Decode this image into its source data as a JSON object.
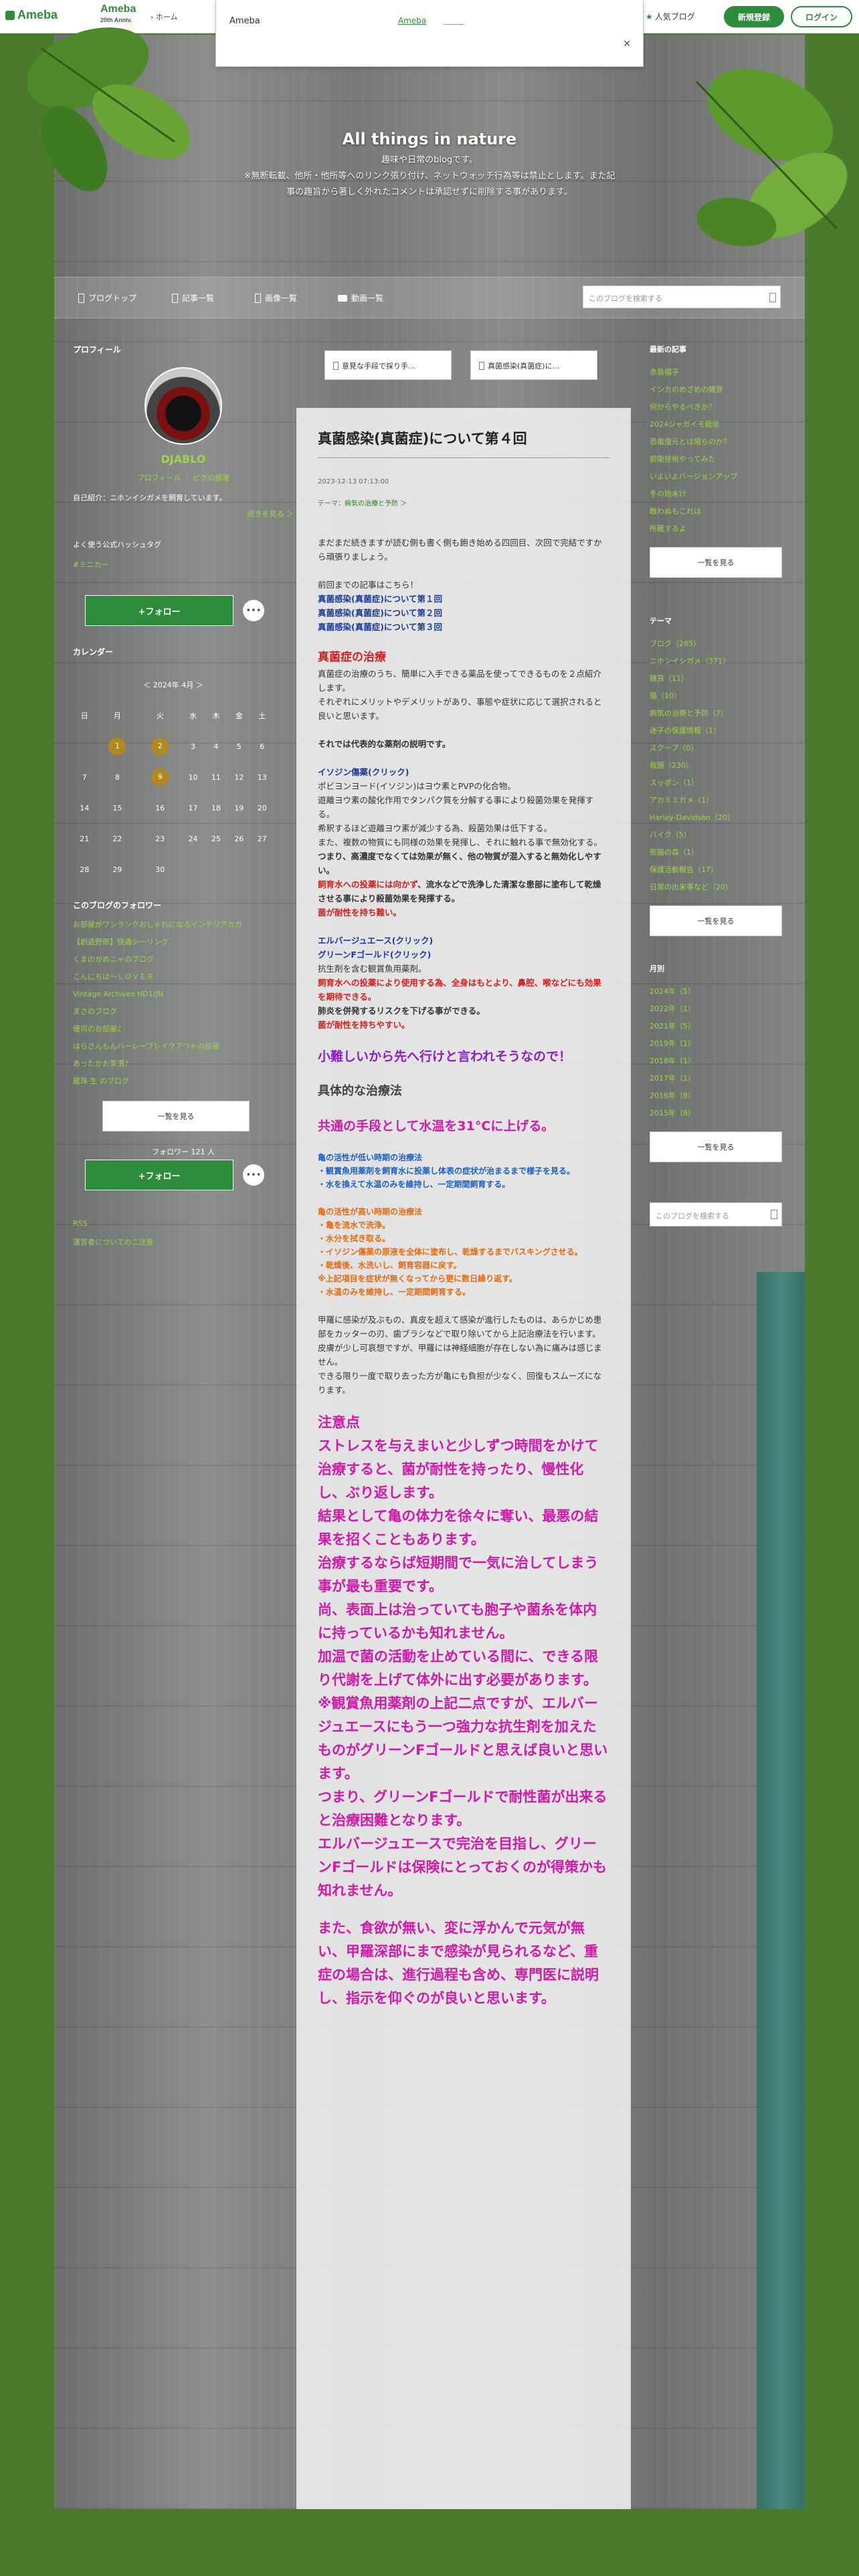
{
  "topbar": {
    "logo": "Ameba",
    "anniv_title": "Ameba",
    "anniv_sub": "20th Anniv.",
    "home": "› ホーム",
    "popular": "人気ブログ",
    "register": "新規登録",
    "login": "ログイン"
  },
  "ad": {
    "label": "Ameba",
    "link": "Ameba",
    "close": "✕"
  },
  "header": {
    "title": "All things in nature",
    "desc_lines": [
      "趣味や日常のblogです。",
      "※無断転載、他所・他所等へのリンク張り付け、ネットウォッチ行為等は禁止とします。また記事の趣旨から著しく外れたコメントは承認せずに削除する事があります。"
    ]
  },
  "nav": {
    "top": "ブログトップ",
    "posts": "記事一覧",
    "images": "画像一覧",
    "videos": "動画一覧",
    "search_placeholder": "このブログを検索する"
  },
  "profile": {
    "heading": "プロフィール",
    "name": "DJABLO",
    "links": "プロフィール ｜ ピグの部屋",
    "intro": "自己紹介：ニホンイシガメを飼育しています。",
    "more": "続きを見る ＞",
    "hash_heading": "よく使う公式ハッシュタグ",
    "hash_tag": "#ミニカー",
    "follow": "+フォロー",
    "dots": "•••"
  },
  "calendar": {
    "heading": "カレンダー",
    "title": "＜  2024年 4月  ＞",
    "weekdays": [
      "日",
      "月",
      "火",
      "水",
      "木",
      "金",
      "土"
    ],
    "rows": [
      [
        "",
        "1",
        "2",
        "3",
        "4",
        "5",
        "6"
      ],
      [
        "7",
        "8",
        "9",
        "10",
        "11",
        "12",
        "13"
      ],
      [
        "14",
        "15",
        "16",
        "17",
        "18",
        "19",
        "20"
      ],
      [
        "21",
        "22",
        "23",
        "24",
        "25",
        "26",
        "27"
      ],
      [
        "28",
        "29",
        "30",
        "",
        "",
        "",
        ""
      ]
    ]
  },
  "followers": {
    "heading": "このブログのフォロワー",
    "items": [
      "お部屋がワンランクおしゃれになるインテリアカガ",
      "【創造野郎】快適シーリング",
      "くまのかめニャのブログ",
      "こんにちは〜ＬＯＶＥＲ",
      "Vintage Archives HD1/JN",
      "まさのブログ",
      "優司のお部屋♪",
      "はらさんもんハーレーブレイクアウトの部屋",
      "あったかお茶漬♪",
      "蔵珠 生 のブログ"
    ],
    "list_btn": "一覧を見る",
    "count": "フォロワー 121 人",
    "follow": "+フォロー"
  },
  "rss": {
    "rss": "RSS",
    "info": "運営者についての二注意"
  },
  "post_nav": {
    "prev": "意見な手段で採り手...",
    "next": "真菌感染(真菌症)に..."
  },
  "post": {
    "title": "真菌感染(真菌症)について第４回",
    "date": "2023-12-13 07:13:00",
    "theme_label": "テーマ：",
    "theme": "病気の治療と予防 ＞",
    "intro": [
      "まだまだ続きますが読む側も書く側も飽き始める四回目、次回で完結ですから頑張りましょう。"
    ],
    "prev_label": "前回までの記事はこちら！",
    "prev_links": [
      "真菌感染(真菌症)について第１回",
      "真菌感染(真菌症)について第２回",
      "真菌感染(真菌症)について第３回"
    ],
    "h_treatment": "真菌症の治療",
    "treatment_text": [
      "真菌症の治療のうち、簡単に入手できる薬品を使ってできるものを２点紹介します。",
      "それぞれにメリットやデメリットがあり、事態や症状に応じて選択されると良いと思います。"
    ],
    "drug_intro": "それでは代表的な薬剤の説明です。",
    "iso_title": "イソジン傷薬(クリック)",
    "iso_text": [
      "ポビヨンヨード(イソジン)はヨウ素とPVPの化合物。",
      "遊離ヨウ素の酸化作用でタンパク質を分解する事により殺菌効果を発揮する。",
      "希釈するほど遊離ヨウ素が減少する為、殺菌効果は低下する。",
      "また、複数の物質にも同様の効果を発揮し、それに触れる事で無効化する。"
    ],
    "iso_bold1": "つまり、高濃度でなくては効果が無く、他の物質が混入すると無効化しやすい。",
    "iso_red1": "飼育水への投薬には向かず",
    "iso_text2": "、流水などで洗浄した清潔な患部に塗布して乾燥させる事により殺菌効果を発揮する。",
    "iso_red2": "菌が耐性を持ち難い。",
    "elba_link": "エルバージュエース(クリック)",
    "green_link": "グリーンFゴールド(クリック)",
    "elba_text": "抗生剤を含む観賞魚用薬剤。",
    "elba_red1": "飼育水への投薬により使用する為、全身はもとより、鼻腔、喉などにも効果を期待できる。",
    "elba_bold": "肺炎を併発するリスクを下げる事ができる。",
    "elba_red2": "菌が耐性を持ちやすい。",
    "h_difficult": "小難しいから先へ行けと言われそうなので！",
    "h_method": "具体的な治療法",
    "h_temp": "共通の手段として水温を31°Cに上げる。",
    "low_title": "亀の活性が低い時期の治療法",
    "low_items": [
      "・観賞魚用薬剤を飼育水に投薬し体表の症状が治まるまで様子を見る。",
      "・水を換えて水温のみを維持し、一定期間飼育する。"
    ],
    "high_title": "亀の活性が高い時期の治療法",
    "high_items": [
      "・亀を流水で洗浄。",
      "・水分を拭き取る。",
      "・イソジン傷薬の原液を全体に塗布し、乾燥するまでバスキングさせる。",
      "・乾燥後、水洗いし、飼育容器に戻す。",
      "※上記項目を症状が無くなってから更に数日繰り返す。",
      "・水温のみを維持し、一定期間飼育する。"
    ],
    "closing": [
      "甲羅に感染が及ぶもの、真皮を超えて感染が進行したものは、あらかじめ患部をカッターの刃、歯ブラシなどで取り除いてから上記治療法を行います。",
      "皮膚が少し可哀想ですが、甲羅には神経細胞が存在しない為に痛みは感じません。",
      "できる限り一度で取り去った方が亀にも負担が少なく、回復もスムーズになります。"
    ],
    "notes": [
      "注意点",
      "ストレスを与えまいと少しずつ時間をかけて治療すると、菌が耐性を持ったり、慢性化し、ぶり返します。",
      "結果として亀の体力を徐々に奪い、最悪の結果を招くこともあります。",
      "治療するならば短期間で一気に治してしまう事が最も重要です。",
      "尚、表面上は治っていても胞子や菌糸を体内に持っているかも知れません。",
      "加温で菌の活動を止めている間に、できる限り代謝を上げて体外に出す必要があります。",
      "※観賞魚用薬剤の上記二点ですが、エルバージュエースにもう一つ強力な抗生剤を加えたものがグリーンFゴールドと思えば良いと思います。",
      "つまり、グリーンFゴールドで耐性菌が出来ると治療困難となります。",
      "エルバージュエースで完治を目指し、グリーンFゴールドは保険にとっておくのが得策かも知れません。",
      "",
      "また、食欲が無い、変に浮かんで元気が無い、甲羅深部にまで感染が見られるなど、重症の場合は、進行過程も含め、専門医に説明し、指示を仰ぐのが良いと思います。"
    ]
  },
  "recent": {
    "heading": "最新の記事",
    "items": [
      "赤島帽子",
      "インカのめざめの雑芽",
      "何からやるべきか？",
      "2024ジャガイモ栽培",
      "恐竜復元とは限らのか？",
      "前衛技術やってみた",
      "いよいよバージョンアップ",
      "冬の始末け",
      "敵わぬもこれは",
      "所蔵するよ"
    ],
    "btn": "一覧を見る"
  },
  "theme": {
    "heading": "テーマ",
    "items": [
      "ブログ（285）",
      "ニホンイシガメ（371）",
      "雑貨（11）",
      "猫（10）",
      "病気の治療と予防（7）",
      "迷子の保護情報（1）",
      "スクープ（0）",
      "栽園（230）",
      "スッポン（1）",
      "アカミミガメ（1）",
      "Harley-Davidson（20）",
      "バイク（5）",
      "熊猫の森（1）",
      "保護活動報告（17）",
      "日常の出来事など（20）"
    ],
    "btn": "一覧を見る"
  },
  "monthly": {
    "heading": "月別",
    "items": [
      "2024年（5）",
      "2022年（1）",
      "2021年（5）",
      "2019年（1）",
      "2018年（1）",
      "2017年（1）",
      "2016年（8）",
      "2015年（8）"
    ],
    "btn": "一覧を見る",
    "search_placeholder": "このブログを検索する"
  }
}
